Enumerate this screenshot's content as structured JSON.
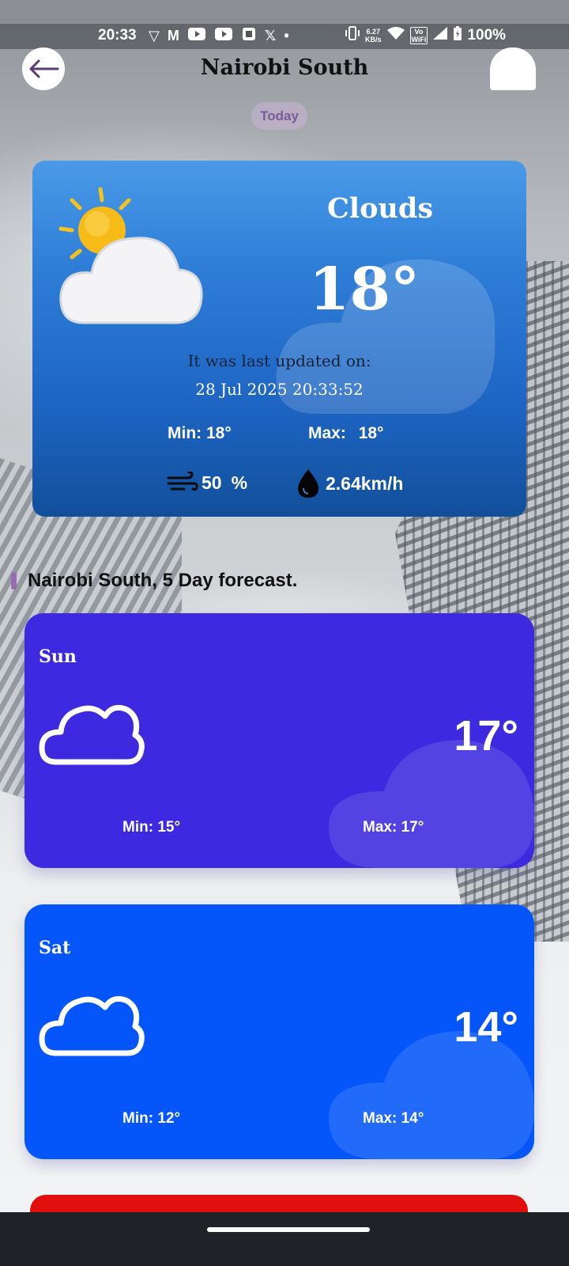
{
  "status_bar": {
    "time": "20:33",
    "speed_value": "6.27",
    "speed_unit": "KB/s",
    "volte": "Vo",
    "wifi_label": "WiFi",
    "battery": "100%",
    "icons": [
      "vpn-icon",
      "gmail-icon",
      "youtube-icon",
      "youtube-icon",
      "app-icon",
      "x-icon",
      "dot-icon",
      "vibrate-icon",
      "wifi-icon",
      "signal-icon",
      "battery-icon"
    ]
  },
  "app_bar": {
    "title": "Nairobi South",
    "back_icon": "arrow-left-icon"
  },
  "chip": {
    "label": "Today"
  },
  "today": {
    "condition": "Clouds",
    "temperature": "18°",
    "updated_label": "It was last updated on:",
    "updated_time": "28 Jul 2025 20:33:52",
    "min_label": "Min:",
    "min_value": "18°",
    "max_label": "Max:",
    "max_value": "18°",
    "wind_value": "50",
    "wind_unit": "%",
    "humidity_value": "2.64km/h",
    "icon": "sun-behind-cloud-icon"
  },
  "forecast": {
    "title": "Nairobi South, 5 Day forecast.",
    "days": [
      {
        "day": "Sun",
        "temp": "17°",
        "min": "Min:  15°",
        "max": "Max: 17°",
        "color": "#3d29e0",
        "icon": "cloud-outline-icon"
      },
      {
        "day": "Sat",
        "temp": "14°",
        "min": "Min:  12°",
        "max": "Max: 14°",
        "color": "#0456fa",
        "icon": "cloud-outline-icon"
      }
    ],
    "next_card_color": "#e20f0f"
  }
}
